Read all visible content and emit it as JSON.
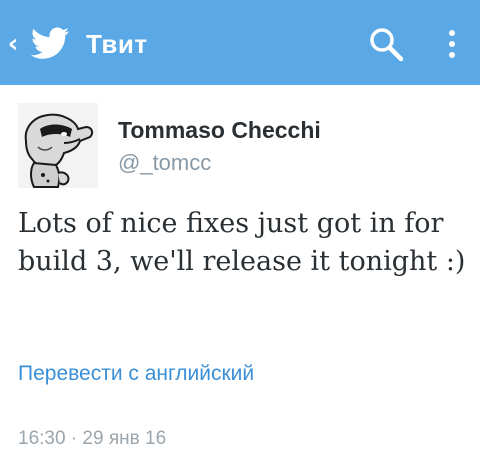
{
  "app_bar": {
    "title": "Твит",
    "back_icon": "chevron-left",
    "logo_icon": "twitter-bird-icon",
    "actions": [
      "search-icon",
      "more-vert-icon"
    ],
    "color": "#5aa9e6"
  },
  "tweet": {
    "author": {
      "name": "Tommaso Checchi",
      "handle": "@_tomcc"
    },
    "text": "Lots of nice fixes just got in for build 3, we'll release it tonight :)",
    "translate_label": "Перевести с английский",
    "timestamp": "16:30 · 29 янв 16"
  }
}
